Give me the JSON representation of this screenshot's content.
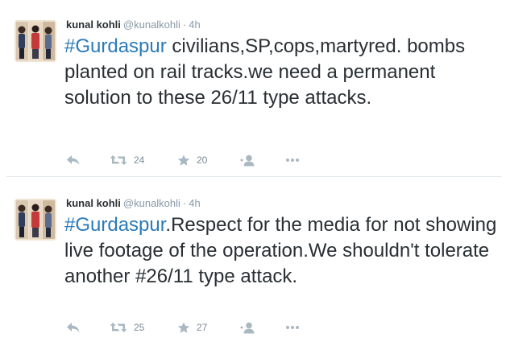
{
  "tweets": [
    {
      "author": {
        "name": "kunal kohli",
        "handle": "@kunalkohli",
        "time": "4h"
      },
      "text": {
        "hashtag": "#Gurdaspur",
        "body": " civilians,SP,cops,martyred. bombs planted on rail tracks.we need a permanent solution to these 26/11 type attacks."
      },
      "stats": {
        "retweets": "24",
        "favorites": "20"
      },
      "icons": [
        "reply-icon",
        "retweet-icon",
        "favorite-icon",
        "follow-icon",
        "more-icon"
      ]
    },
    {
      "author": {
        "name": "kunal kohli",
        "handle": "@kunalkohli",
        "time": "4h"
      },
      "text": {
        "hashtag": "#Gurdaspur",
        "body": ".Respect for the media for not showing live footage of the operation.We shouldn't tolerate another #26/11 type attack."
      },
      "stats": {
        "retweets": "25",
        "favorites": "27"
      },
      "icons": [
        "reply-icon",
        "retweet-icon",
        "favorite-icon",
        "follow-icon",
        "more-icon"
      ]
    }
  ],
  "ui": {
    "separator": "·"
  },
  "colors": {
    "text": "#292f33",
    "muted": "#8899a6",
    "hashtag": "#2b7bb9",
    "icon": "#aab8c2",
    "divider": "#e1e8ed"
  }
}
